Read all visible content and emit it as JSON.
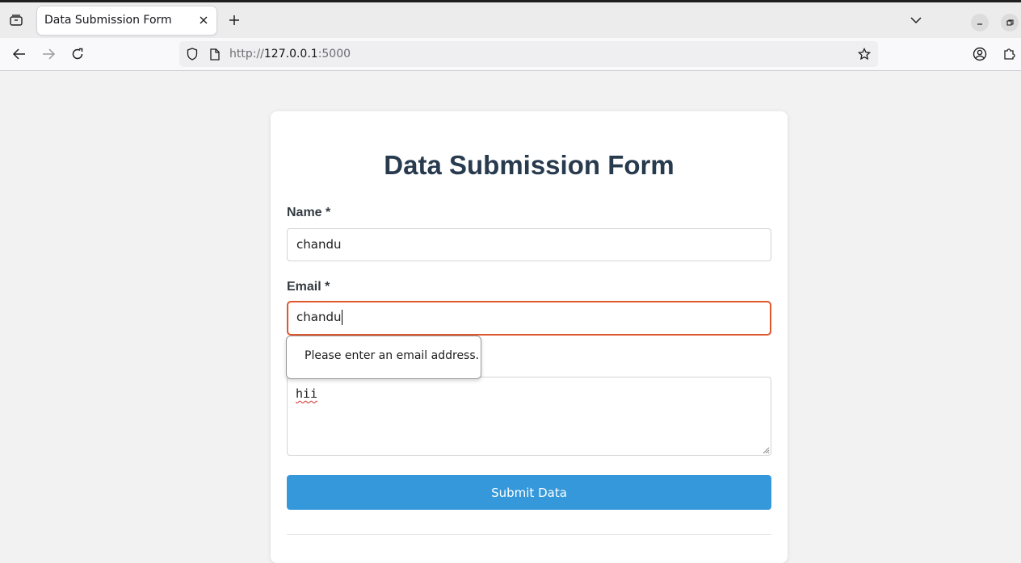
{
  "browser": {
    "tab_title": "Data Submission Form",
    "url_scheme": "http://",
    "url_host": "127.0.0.1",
    "url_port": ":5000"
  },
  "form": {
    "title": "Data Submission Form",
    "name_label": "Name *",
    "name_value": "chandu",
    "email_label": "Email *",
    "email_value": "chandu",
    "message_value": "hii",
    "submit_label": "Submit Data"
  },
  "validation": {
    "email_tooltip": "Please enter an email address."
  },
  "colors": {
    "accent": "#3498db",
    "title": "#283a4e",
    "invalid_border": "#e0572d"
  }
}
